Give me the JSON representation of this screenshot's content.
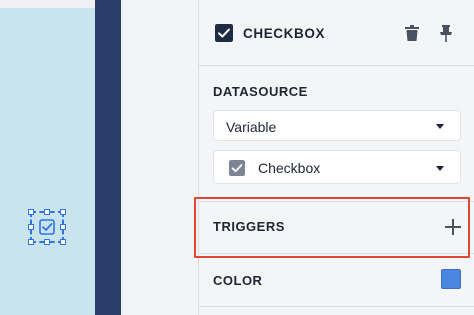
{
  "header": {
    "title": "CHECKBOX"
  },
  "datasource": {
    "label": "DATASOURCE",
    "type_select": {
      "value": "Variable"
    },
    "variable_select": {
      "value": "Checkbox"
    }
  },
  "triggers": {
    "label": "TRIGGERS"
  },
  "color": {
    "label": "COLOR",
    "value": "#4a86e0"
  },
  "icons": {
    "header": "checkbox-checked-icon",
    "delete": "trash-icon",
    "pin": "pin-icon",
    "add": "plus-icon",
    "variable": "checkbox-variable-icon",
    "canvas_widget": "checkbox-widget-icon"
  },
  "colors": {
    "canvas_background": "#c9e4ec",
    "side_strip": "#2b3d6b",
    "selection": "#2f74e6",
    "highlight": "#dd4734"
  }
}
